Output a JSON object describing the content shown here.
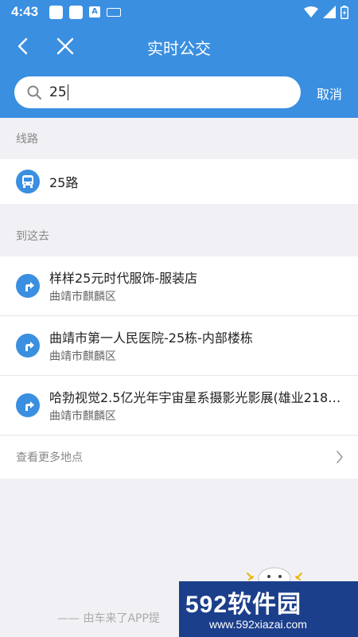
{
  "status_bar": {
    "time": "4:43",
    "a_badge": "A"
  },
  "header": {
    "title": "实时公交"
  },
  "search": {
    "query": "25",
    "cancel_label": "取消"
  },
  "routes": {
    "section_label": "线路",
    "items": [
      {
        "label": "25路"
      }
    ]
  },
  "destinations": {
    "section_label": "到这去",
    "items": [
      {
        "name": "样样25元时代服饰-服装店",
        "area": "曲靖市麒麟区"
      },
      {
        "name": "曲靖市第一人民医院-25栋-内部楼栋",
        "area": "曲靖市麒麟区"
      },
      {
        "name": "哈勃视觉2.5亿光年宇宙星系摄影光影展(雄业218…",
        "area": "曲靖市麒麟区"
      }
    ],
    "more_label": "查看更多地点"
  },
  "footer": {
    "text": "—— 由车来了APP提"
  },
  "watermark": {
    "brand": "592软件园",
    "url": "www.592xiazai.com"
  },
  "colors": {
    "primary": "#3a8fe0",
    "background": "#f1f1f5",
    "watermark": "#1c3f8c"
  }
}
